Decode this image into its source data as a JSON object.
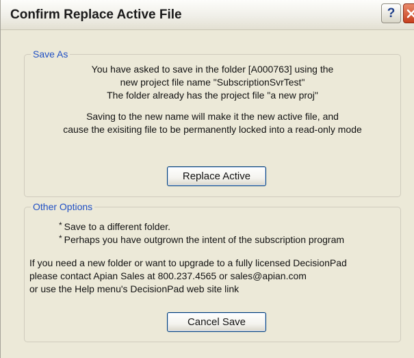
{
  "window": {
    "title": "Confirm Replace Active File",
    "help_glyph": "?",
    "close_icon": "close-x-icon"
  },
  "save_as": {
    "legend": "Save As",
    "lines": [
      "You have asked to save in the folder [A000763] using the",
      "new project file name \"SubscriptionSvrTest\"",
      "The folder already has the project file \"a new proj\"",
      "Saving to the new name will make it the new active file, and",
      "cause the exisiting file to be permanently locked into a read-only mode"
    ],
    "button_label": "Replace Active"
  },
  "other_options": {
    "legend": "Other Options",
    "bullet_glyph": "*",
    "bullets": [
      "Save to a different folder.",
      "Perhaps you have outgrown the intent of the subscription program"
    ],
    "info_lines": [
      "If you need a new folder or want to upgrade to a fully licensed DecisionPad",
      "please contact Apian Sales at 800.237.4565 or sales@apian.com",
      "or use the Help menu's DecisionPad web site link"
    ],
    "button_label": "Cancel Save"
  },
  "colors": {
    "dialog_background": "#ece9d8",
    "legend_text": "#1f4fc4",
    "close_button": "#c7401f",
    "button_border": "#003c74"
  }
}
